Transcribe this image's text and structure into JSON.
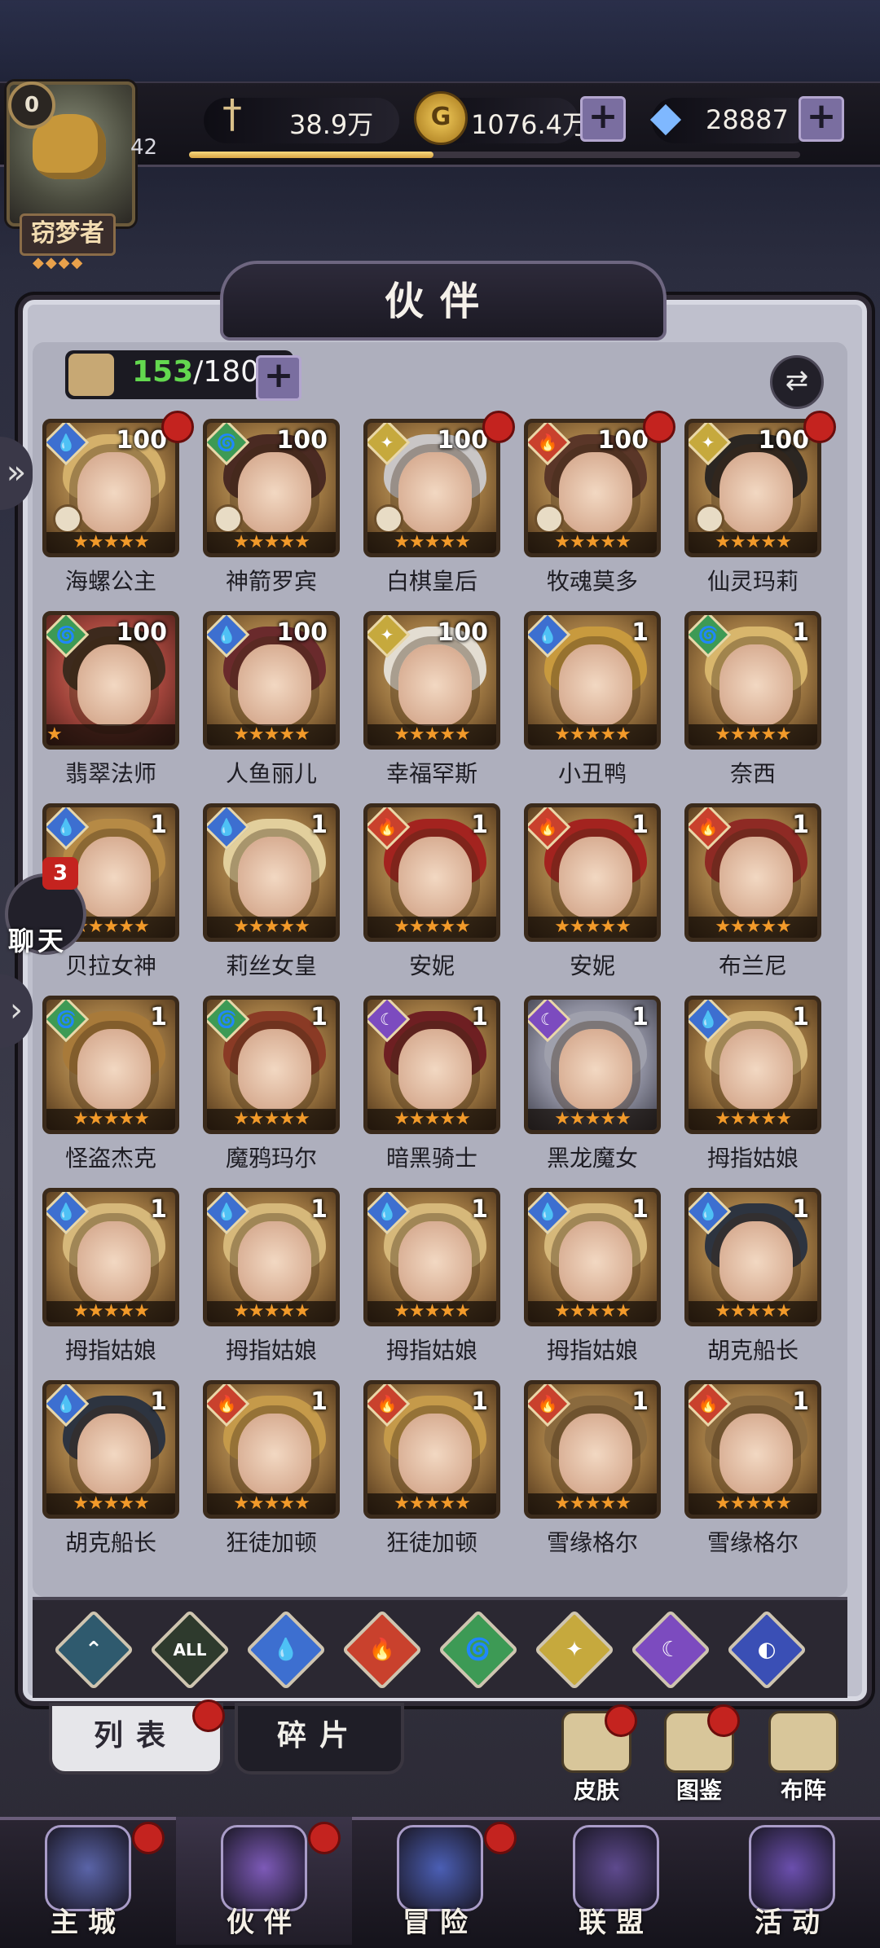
{
  "player": {
    "level_badge": "0",
    "level": "42",
    "title": "窃梦者",
    "title_diamonds": "◆◆◆◆",
    "xp_fraction": 0.4
  },
  "currency": {
    "power": "38.9万",
    "gold": "1076.4万",
    "gems": "28887",
    "plus": "+"
  },
  "panel": {
    "title": "伙伴",
    "count_current": "153",
    "count_max": "/180",
    "swap_icon": "⇄"
  },
  "heroes": [
    {
      "name": "海螺公主",
      "level": "100",
      "element": "water",
      "stars": 5,
      "red_dot": true,
      "crown": true,
      "hair": "#d4b06a"
    },
    {
      "name": "神箭罗宾",
      "level": "100",
      "element": "wind",
      "stars": 5,
      "red_dot": false,
      "crown": true,
      "hair": "#4a2a22"
    },
    {
      "name": "白棋皇后",
      "level": "100",
      "element": "light",
      "stars": 5,
      "red_dot": true,
      "crown": true,
      "hair": "#c9c6c6"
    },
    {
      "name": "牧魂莫多",
      "level": "100",
      "element": "fire",
      "stars": 5,
      "red_dot": true,
      "crown": true,
      "hair": "#5a3628"
    },
    {
      "name": "仙灵玛莉",
      "level": "100",
      "element": "light",
      "stars": 5,
      "red_dot": true,
      "crown": true,
      "hair": "#2b2622"
    },
    {
      "name": "翡翠法师",
      "level": "100",
      "element": "wind",
      "stars": 1,
      "red_dot": false,
      "crown": false,
      "hair": "#3d2a1d",
      "card": "c-red"
    },
    {
      "name": "人鱼丽儿",
      "level": "100",
      "element": "water",
      "stars": 5,
      "red_dot": false,
      "crown": false,
      "hair": "#6a2a2c"
    },
    {
      "name": "幸福罕斯",
      "level": "100",
      "element": "light",
      "stars": 5,
      "red_dot": false,
      "crown": false,
      "hair": "#e3ddd2"
    },
    {
      "name": "小丑鸭",
      "level": "1",
      "element": "water",
      "stars": 5,
      "red_dot": false,
      "crown": false,
      "hair": "#c89a3e"
    },
    {
      "name": "奈西",
      "level": "1",
      "element": "wind",
      "stars": 5,
      "red_dot": false,
      "crown": false,
      "hair": "#d8b66c"
    },
    {
      "name": "贝拉女神",
      "level": "1",
      "element": "water",
      "stars": 5,
      "red_dot": false,
      "crown": false,
      "hair": "#b68a45"
    },
    {
      "name": "莉丝女皇",
      "level": "1",
      "element": "water",
      "stars": 5,
      "red_dot": false,
      "crown": false,
      "hair": "#e2cf9c"
    },
    {
      "name": "安妮",
      "level": "1",
      "element": "fire",
      "stars": 5,
      "red_dot": false,
      "crown": false,
      "hair": "#a3231f"
    },
    {
      "name": "安妮",
      "level": "1",
      "element": "fire",
      "stars": 5,
      "red_dot": false,
      "crown": false,
      "hair": "#a3231f"
    },
    {
      "name": "布兰尼",
      "level": "1",
      "element": "fire",
      "stars": 5,
      "red_dot": false,
      "crown": false,
      "hair": "#8e2a24"
    },
    {
      "name": "怪盗杰克",
      "level": "1",
      "element": "wind",
      "stars": 5,
      "red_dot": false,
      "crown": false,
      "hair": "#a87a3a"
    },
    {
      "name": "魔鸦玛尔",
      "level": "1",
      "element": "wind",
      "stars": 5,
      "red_dot": false,
      "crown": false,
      "hair": "#8a3a25"
    },
    {
      "name": "暗黑骑士",
      "level": "1",
      "element": "dark",
      "stars": 5,
      "red_dot": false,
      "crown": false,
      "hair": "#6e1f22"
    },
    {
      "name": "黑龙魔女",
      "level": "1",
      "element": "dark",
      "stars": 5,
      "red_dot": false,
      "crown": false,
      "hair": "#9fa0ac",
      "card": "c-mint"
    },
    {
      "name": "拇指姑娘",
      "level": "1",
      "element": "water",
      "stars": 5,
      "red_dot": false,
      "crown": false,
      "hair": "#d6b87a"
    },
    {
      "name": "拇指姑娘",
      "level": "1",
      "element": "water",
      "stars": 5,
      "red_dot": false,
      "crown": false,
      "hair": "#d6b87a"
    },
    {
      "name": "拇指姑娘",
      "level": "1",
      "element": "water",
      "stars": 5,
      "red_dot": false,
      "crown": false,
      "hair": "#d6b87a"
    },
    {
      "name": "拇指姑娘",
      "level": "1",
      "element": "water",
      "stars": 5,
      "red_dot": false,
      "crown": false,
      "hair": "#d6b87a"
    },
    {
      "name": "拇指姑娘",
      "level": "1",
      "element": "water",
      "stars": 5,
      "red_dot": false,
      "crown": false,
      "hair": "#d6b87a"
    },
    {
      "name": "胡克船长",
      "level": "1",
      "element": "water",
      "stars": 5,
      "red_dot": false,
      "crown": false,
      "hair": "#2d3440"
    },
    {
      "name": "胡克船长",
      "level": "1",
      "element": "water",
      "stars": 5,
      "red_dot": false,
      "crown": false,
      "hair": "#2d3440"
    },
    {
      "name": "狂徒加顿",
      "level": "1",
      "element": "fire",
      "stars": 5,
      "red_dot": false,
      "crown": false,
      "hair": "#c59a4a"
    },
    {
      "name": "狂徒加顿",
      "level": "1",
      "element": "fire",
      "stars": 5,
      "red_dot": false,
      "crown": false,
      "hair": "#c59a4a"
    },
    {
      "name": "雪缘格尔",
      "level": "1",
      "element": "fire",
      "stars": 5,
      "red_dot": false,
      "crown": false,
      "hair": "#8a6a3e"
    },
    {
      "name": "雪缘格尔",
      "level": "1",
      "element": "fire",
      "stars": 5,
      "red_dot": false,
      "crown": false,
      "hair": "#8a6a3e"
    }
  ],
  "element_colors": {
    "water": "#3d6fd0",
    "wind": "#3d9a55",
    "light": "#c6a93d",
    "fire": "#c9412d",
    "dark": "#7c4bbf"
  },
  "element_glyphs": {
    "water": "💧",
    "wind": "🌀",
    "light": "✦",
    "fire": "🔥",
    "dark": "☾"
  },
  "filters": [
    {
      "id": "all-arrow",
      "glyph": "⌃",
      "color": "#2f5a6e"
    },
    {
      "id": "all",
      "glyph": "ALL",
      "color": "#2e3a2d"
    },
    {
      "id": "water",
      "glyph": "💧",
      "color": "#3d6fd0"
    },
    {
      "id": "fire",
      "glyph": "🔥",
      "color": "#c9412d"
    },
    {
      "id": "wind",
      "glyph": "🌀",
      "color": "#3d9a55"
    },
    {
      "id": "light",
      "glyph": "✦",
      "color": "#c6a93d"
    },
    {
      "id": "dark",
      "glyph": "☾",
      "color": "#7c4bbf"
    },
    {
      "id": "cosmic",
      "glyph": "◐",
      "color": "#3a4fb5"
    }
  ],
  "subtabs": {
    "list": "列表",
    "fragments": "碎片"
  },
  "side_buttons": {
    "skin": "皮肤",
    "codex": "图鉴",
    "formation": "布阵"
  },
  "chat": {
    "count": "3",
    "label": "聊天",
    "arrow": "»",
    "arrow2": "›"
  },
  "nav": [
    {
      "label": "主城",
      "color": "#5a64a8",
      "icon": "castle-icon"
    },
    {
      "label": "伙伴",
      "color": "#7d5ab8",
      "icon": "witch-hat-icon"
    },
    {
      "label": "冒险",
      "color": "#4b5fb5",
      "icon": "compass-icon"
    },
    {
      "label": "联盟",
      "color": "#5e4a8e",
      "icon": "shield-icon"
    },
    {
      "label": "活动",
      "color": "#6b4fae",
      "icon": "cards-icon"
    }
  ]
}
